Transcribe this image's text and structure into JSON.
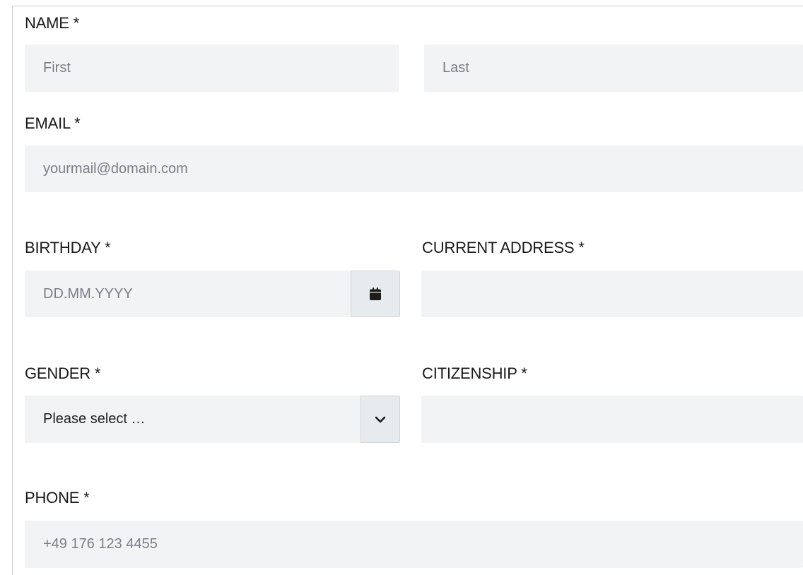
{
  "form": {
    "name": {
      "label": "NAME *",
      "first_placeholder": "First",
      "last_placeholder": "Last"
    },
    "email": {
      "label": "EMAIL *",
      "placeholder": "yourmail@domain.com"
    },
    "birthday": {
      "label": "BIRTHDAY *",
      "placeholder": "DD.MM.YYYY",
      "icon": "calendar-icon"
    },
    "current_address": {
      "label": "CURRENT ADDRESS *",
      "placeholder": ""
    },
    "gender": {
      "label": "GENDER *",
      "selected": "Please select …",
      "icon": "chevron-down-icon"
    },
    "citizenship": {
      "label": "CITIZENSHIP *",
      "placeholder": ""
    },
    "phone": {
      "label": "PHONE *",
      "placeholder": "+49 176 123 4455"
    }
  },
  "colors": {
    "field_background": "#f2f3f5",
    "addon_background": "#e8ebee",
    "label_text": "#1a1a1a",
    "placeholder_text": "#7a7f86"
  }
}
